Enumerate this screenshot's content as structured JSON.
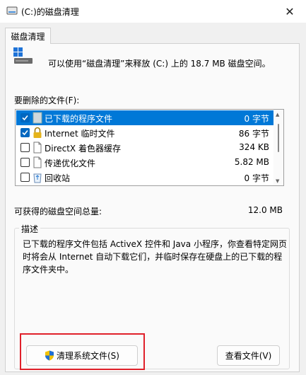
{
  "window": {
    "title": "(C:)的磁盘清理",
    "close_glyph": "✕"
  },
  "tab": {
    "label": "磁盘清理"
  },
  "intro": {
    "text": "可以使用“磁盘清理”来释放  (C:) 上的 18.7 MB 磁盘空间。"
  },
  "files": {
    "label": "要删除的文件(F):",
    "items": [
      {
        "name": "已下载的程序文件",
        "size": "0 字节",
        "checked": true,
        "selected": true,
        "icon": "folder-icon"
      },
      {
        "name": "Internet 临时文件",
        "size": "86 字节",
        "checked": true,
        "selected": false,
        "icon": "lock-icon"
      },
      {
        "name": "DirectX 着色器缓存",
        "size": "324 KB",
        "checked": false,
        "selected": false,
        "icon": "file-icon"
      },
      {
        "name": "传递优化文件",
        "size": "5.82 MB",
        "checked": false,
        "selected": false,
        "icon": "file-icon"
      },
      {
        "name": "回收站",
        "size": "0 字节",
        "checked": false,
        "selected": false,
        "icon": "recycle-bin-icon"
      }
    ]
  },
  "total": {
    "label": "可获得的磁盘空间总量:",
    "value": "12.0 MB"
  },
  "description": {
    "legend": "描述",
    "text": "已下载的程序文件包括 ActiveX 控件和 Java 小程序，你查看特定网页时将会从 Internet 自动下载它们，并临时保存在硬盘上的已下载的程序文件夹中。"
  },
  "buttons": {
    "clean_system": "清理系统文件(S)",
    "view_files": "查看文件(V)"
  },
  "colors": {
    "selection": "#0078d7",
    "checkbox": "#0067c0",
    "highlight": "#e0202a"
  }
}
